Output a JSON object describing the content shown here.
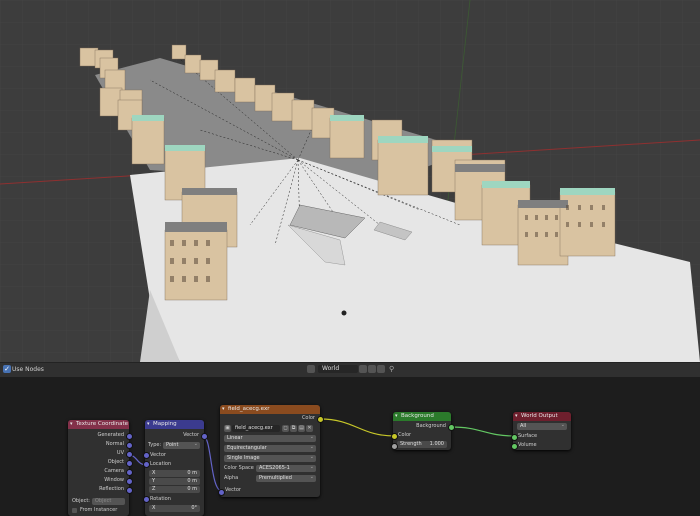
{
  "header": {
    "use_nodes_label": "Use Nodes",
    "world_label": "World"
  },
  "nodes": {
    "texcoord": {
      "title": "Texture Coordinate",
      "outputs": [
        "Generated",
        "Normal",
        "UV",
        "Object",
        "Camera",
        "Window",
        "Reflection"
      ],
      "object_label": "Object:",
      "object_placeholder": "Object",
      "from_instancer": "From Instancer"
    },
    "mapping": {
      "title": "Mapping",
      "output": "Vector",
      "type_label": "Type:",
      "type_value": "Point",
      "vector_label": "Vector",
      "location_label": "Location",
      "loc_x_label": "X",
      "loc_x_value": "0 m",
      "loc_y_label": "Y",
      "loc_y_value": "0 m",
      "loc_z_label": "Z",
      "loc_z_value": "0 m",
      "rotation_label": "Rotation",
      "rot_x_label": "X",
      "rot_x_value": "0°"
    },
    "envtex": {
      "title": "field_acecg.exr",
      "output": "Color",
      "image_name": "field_acecg.exr",
      "interpolation": "Linear",
      "projection": "Equirectangular",
      "source": "Single Image",
      "colorspace_label": "Color Space",
      "colorspace_value": "ACES2065-1",
      "alpha_label": "Alpha",
      "alpha_value": "Premultiplied",
      "vector_input": "Vector"
    },
    "background": {
      "title": "Background",
      "output": "Background",
      "color_input": "Color",
      "strength_label": "Strength",
      "strength_value": "1.000"
    },
    "worldoutput": {
      "title": "World Output",
      "target": "All",
      "surface_input": "Surface",
      "volume_input": "Volume"
    }
  },
  "colors": {
    "texcoord_header": "#83314a",
    "mapping_header": "#3b3b8f",
    "envtex_header": "#8a4b1f",
    "background_header": "#2b7a2b",
    "worldoutput_header": "#6e1f2d",
    "color_wire": "#c7c729",
    "vector_wire": "#6363c7",
    "shader_wire": "#63c763"
  }
}
